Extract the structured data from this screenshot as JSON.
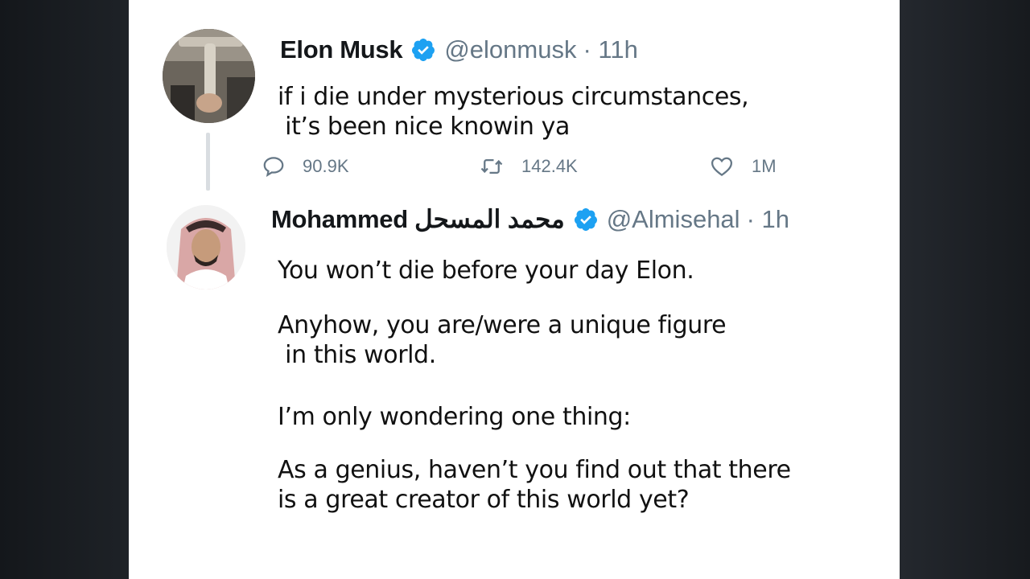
{
  "tweet": {
    "author_name": "Elon Musk",
    "author_handle": "@elonmusk",
    "time": "· 11h",
    "text_line1": "if i die under mysterious circumstances,",
    "text_line2": " it’s been nice knowin ya",
    "replies": "90.9K",
    "retweets": "142.4K",
    "likes": "1M"
  },
  "reply": {
    "author_name": "Mohammed محمد المسحل",
    "author_handle": "@Almisehal",
    "time": "· 1h",
    "para1": "You won’t die before your day Elon.",
    "para2_line1": "Anyhow, you are/were a unique figure",
    "para2_line2": " in this world.",
    "para3": "I’m only wondering one thing:",
    "para4_line1": "As a genius, haven’t you find out that there",
    "para4_line2": "is a great creator of this world yet?"
  },
  "icons": {
    "verified": "verified-badge-icon",
    "reply": "reply-icon",
    "retweet": "retweet-icon",
    "like": "heart-icon"
  },
  "colors": {
    "verified": "#1da1f2",
    "muted": "#657786",
    "text": "#14171a"
  }
}
